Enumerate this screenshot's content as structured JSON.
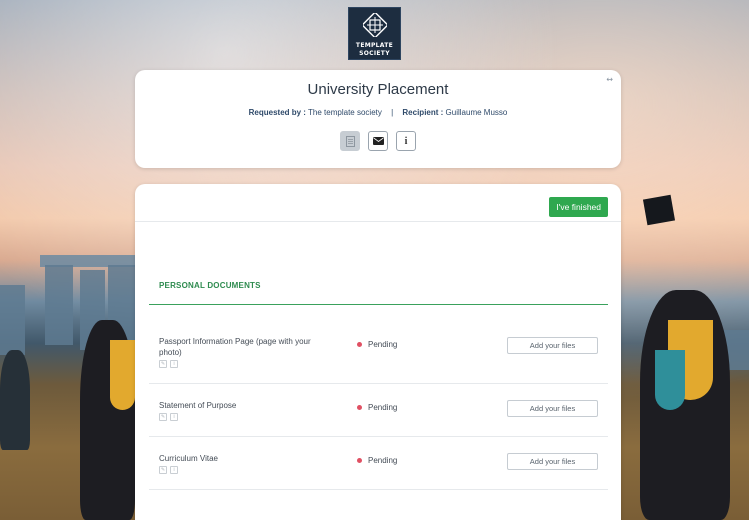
{
  "logo": {
    "line1": "TEMPLATE",
    "line2": "SOCIETY"
  },
  "header": {
    "title": "University Placement",
    "requested_by_label": "Requested by :",
    "requested_by_value": "The template society",
    "separator": "|",
    "recipient_label": "Recipient :",
    "recipient_value": "Guillaume Musso",
    "collapse_glyph": "↔",
    "info_glyph": "i"
  },
  "toolbar": {
    "finish_label": "I've finished"
  },
  "section": {
    "title": "PERSONAL DOCUMENTS"
  },
  "documents": [
    {
      "name": "Passport Information Page (page with your photo)",
      "status": "Pending",
      "upload_label": "Add your files"
    },
    {
      "name": "Statement of Purpose",
      "status": "Pending",
      "upload_label": "Add your files"
    },
    {
      "name": "Curriculum Vitae",
      "status": "Pending",
      "upload_label": "Add your files"
    }
  ],
  "colors": {
    "accent_green": "#2fa84f",
    "pending_dot": "#e05063",
    "logo_bg": "#1d2d40"
  },
  "icons": [
    "document-icon",
    "envelope-icon",
    "info-icon",
    "collapse-icon",
    "edit-icon",
    "info-small-icon"
  ]
}
